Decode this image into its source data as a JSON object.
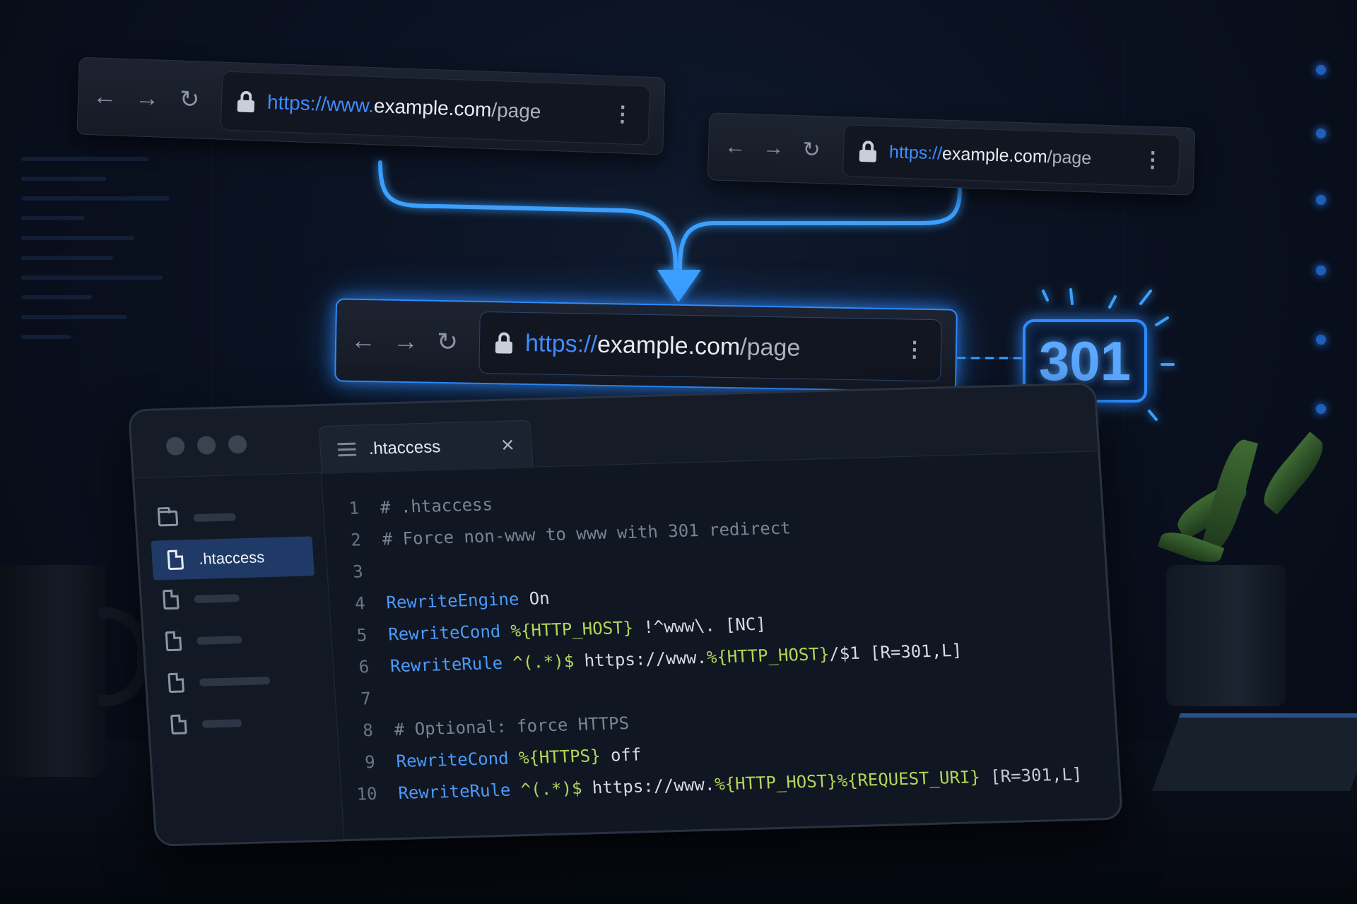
{
  "browsers": {
    "top_left": {
      "url": {
        "scheme": "https://",
        "subdomain": "www.",
        "host": "example.com",
        "path": "/page"
      }
    },
    "top_right": {
      "url": {
        "scheme": "https://",
        "host": "example.com",
        "path": "/page"
      }
    },
    "target": {
      "url": {
        "scheme": "https://",
        "host": "example.com",
        "path": "/page"
      }
    }
  },
  "status_badge": "301",
  "editor": {
    "tab_label": ".htaccess",
    "sidebar": {
      "active_file": ".htaccess"
    },
    "code_lines": [
      {
        "n": "1",
        "parts": [
          {
            "t": "# .htaccess",
            "k": "comment"
          }
        ]
      },
      {
        "n": "2",
        "parts": [
          {
            "t": "# Force non-www to www with 301 redirect",
            "k": "comment"
          }
        ]
      },
      {
        "n": "3",
        "parts": []
      },
      {
        "n": "4",
        "parts": [
          {
            "t": "RewriteEngine",
            "k": "dir"
          },
          {
            "t": " On",
            "k": "text"
          }
        ]
      },
      {
        "n": "5",
        "parts": [
          {
            "t": "RewriteCond",
            "k": "dir"
          },
          {
            "t": " %{HTTP_HOST}",
            "k": "var"
          },
          {
            "t": " !^www\\. [NC]",
            "k": "text"
          }
        ]
      },
      {
        "n": "6",
        "parts": [
          {
            "t": "RewriteRule",
            "k": "dir"
          },
          {
            "t": " ^(.*)$",
            "k": "var"
          },
          {
            "t": " https://www.",
            "k": "text"
          },
          {
            "t": "%{HTTP_HOST}",
            "k": "var"
          },
          {
            "t": "/$1 [R=301,L]",
            "k": "text"
          }
        ]
      },
      {
        "n": "7",
        "parts": []
      },
      {
        "n": "8",
        "parts": [
          {
            "t": "# Optional: force HTTPS",
            "k": "comment"
          }
        ]
      },
      {
        "n": "9",
        "parts": [
          {
            "t": "RewriteCond",
            "k": "dir"
          },
          {
            "t": " %{HTTPS}",
            "k": "var"
          },
          {
            "t": " off",
            "k": "text"
          }
        ]
      },
      {
        "n": "10",
        "parts": [
          {
            "t": "RewriteRule",
            "k": "dir"
          },
          {
            "t": " ^(.*)$",
            "k": "var"
          },
          {
            "t": " https://www.",
            "k": "text"
          },
          {
            "t": "%{HTTP_HOST}%{REQUEST_URI}",
            "k": "var"
          },
          {
            "t": " [R=301,L]",
            "k": "flag"
          }
        ]
      }
    ]
  },
  "icons": [
    "back-icon",
    "forward-icon",
    "reload-icon",
    "lock-icon",
    "more-icon",
    "menu-icon",
    "close-icon",
    "folder-icon",
    "file-icon"
  ],
  "colors": {
    "accent": "#2f8bff",
    "directive": "#4c9aff",
    "variable": "#b6d45a",
    "comment": "#7a8394"
  }
}
